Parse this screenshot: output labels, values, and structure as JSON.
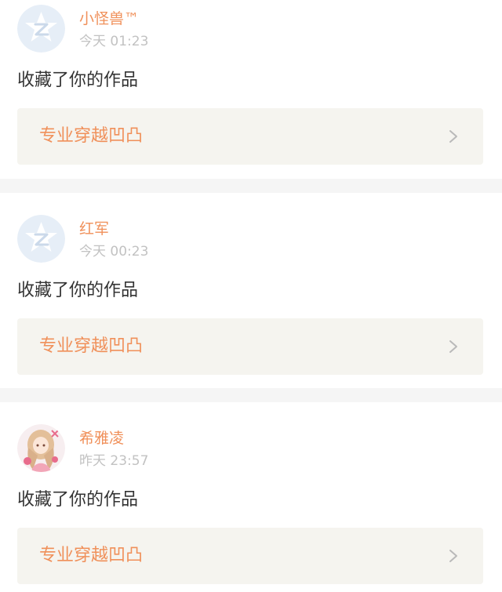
{
  "items": [
    {
      "user": "小怪兽™",
      "time": "今天 01:23",
      "action": "收藏了你的作品",
      "work_title": "专业穿越凹凸",
      "avatar_icon": "default-star-avatar-icon"
    },
    {
      "user": "红军",
      "time": "今天 00:23",
      "action": "收藏了你的作品",
      "work_title": "专业穿越凹凸",
      "avatar_icon": "default-star-avatar-icon"
    },
    {
      "user": "希雅凌",
      "time": "昨天 23:57",
      "action": "收藏了你的作品",
      "work_title": "专业穿越凹凸",
      "avatar_icon": "anime-girl-avatar-icon"
    }
  ],
  "colors": {
    "accent": "#f0905a",
    "timestamp": "#c2c2c2",
    "body_text": "#333333",
    "card_box": "#f5f4ef",
    "divider": "#f5f5f5",
    "default_avatar_bg": "#e6eef7"
  }
}
